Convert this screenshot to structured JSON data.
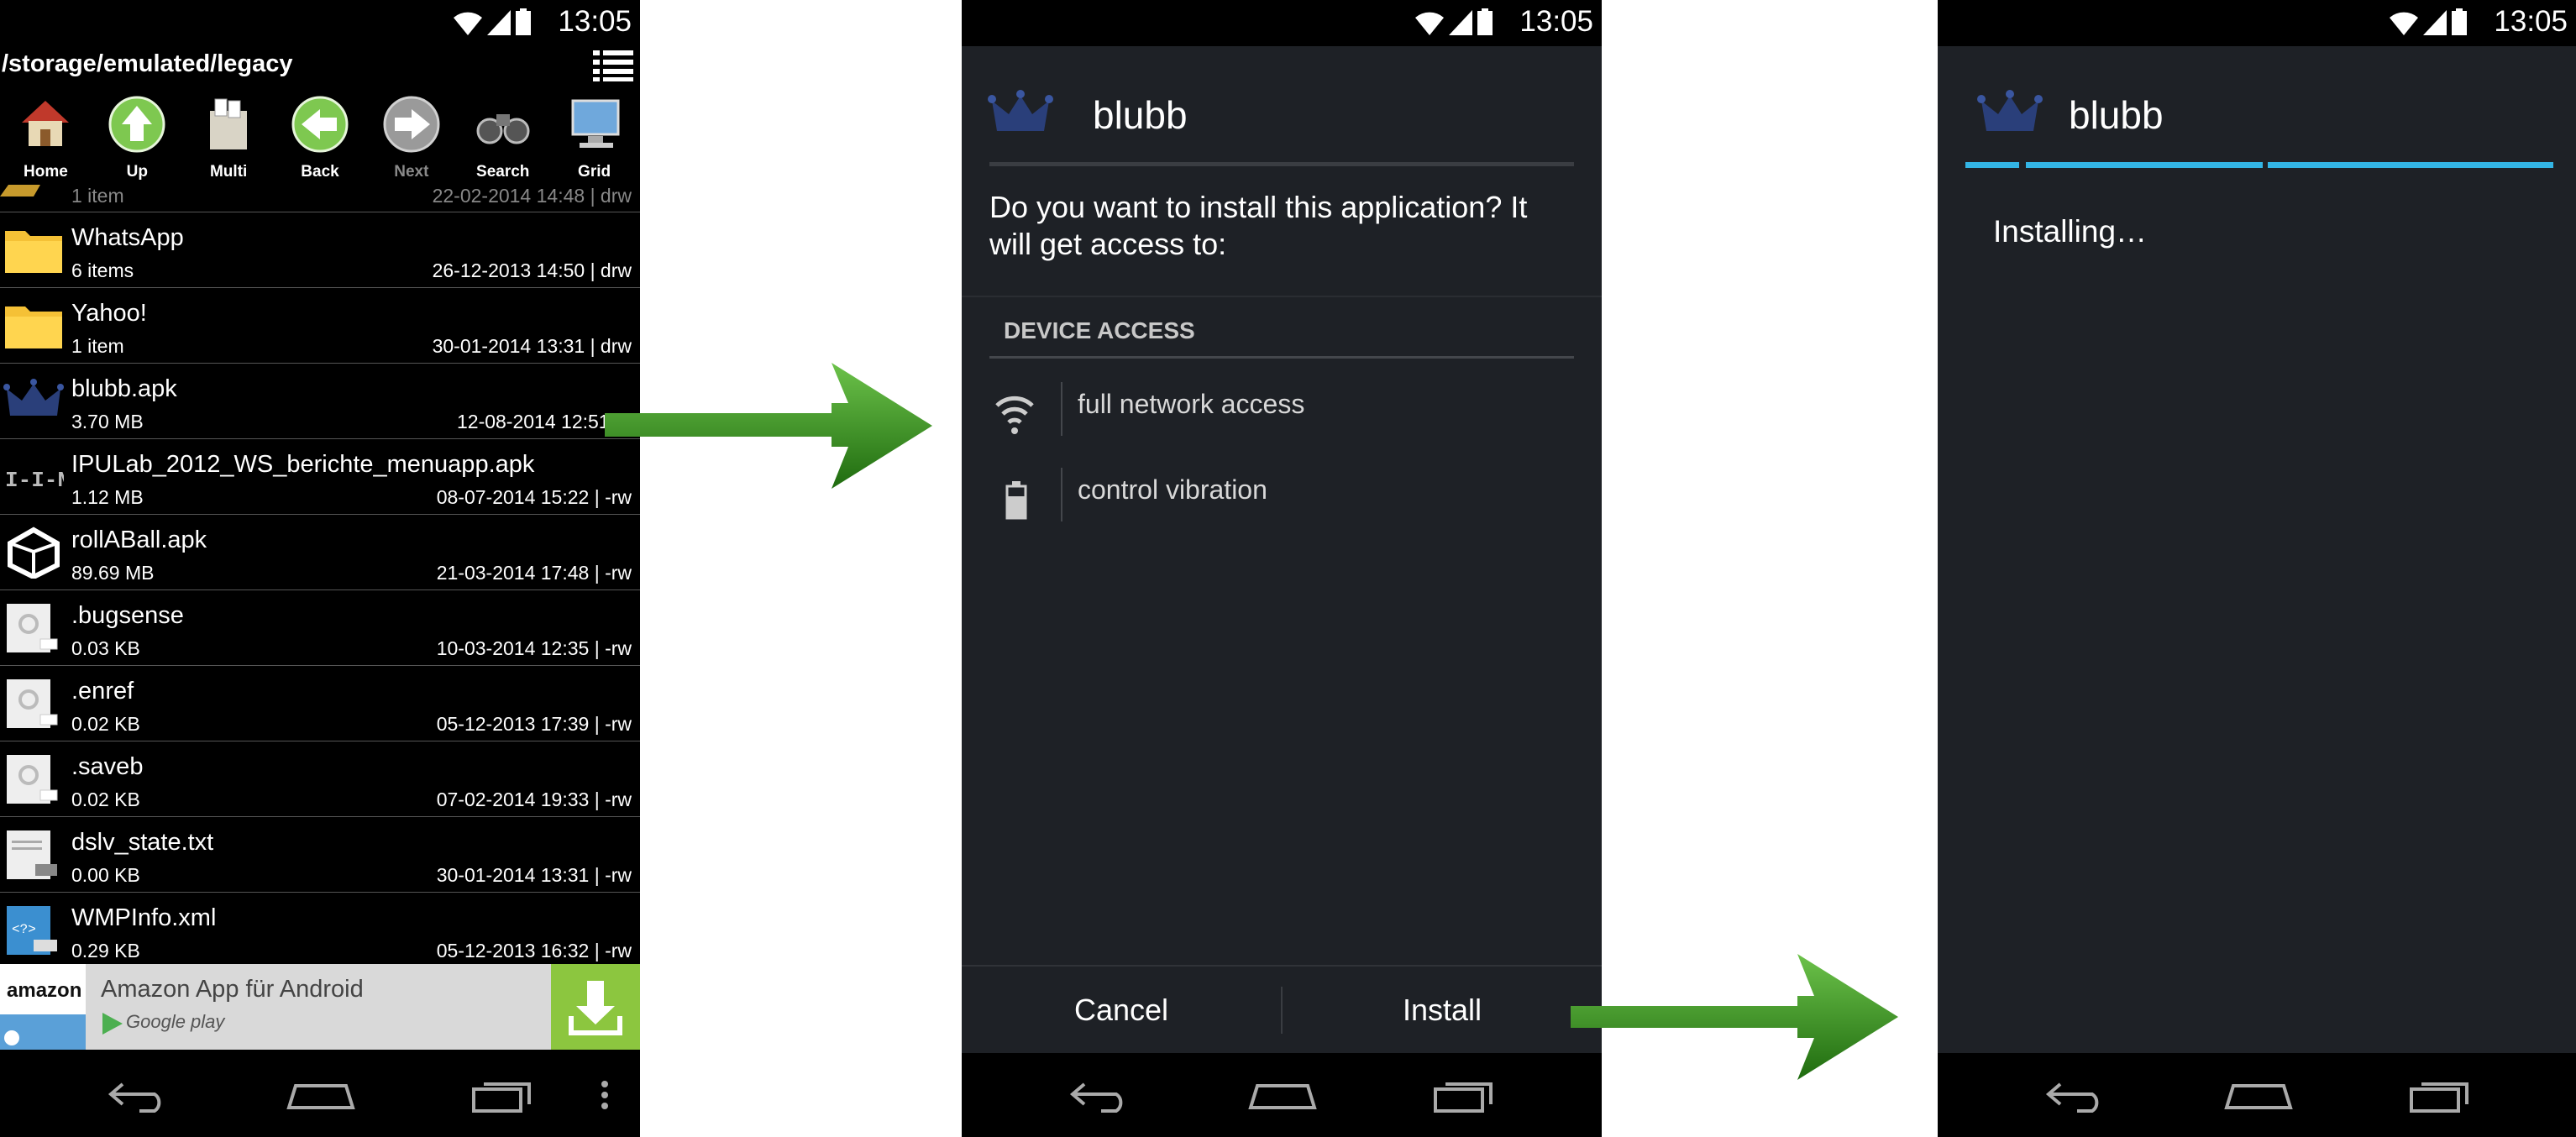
{
  "status": {
    "time": "13:05"
  },
  "file_manager": {
    "path": "/storage/emulated/legacy",
    "toolbar": [
      {
        "label": "Home",
        "icon": "home-icon"
      },
      {
        "label": "Up",
        "icon": "up-arrow-icon"
      },
      {
        "label": "Multi",
        "icon": "multi-select-icon"
      },
      {
        "label": "Back",
        "icon": "back-arrow-icon"
      },
      {
        "label": "Next",
        "icon": "next-arrow-icon"
      },
      {
        "label": "Search",
        "icon": "binoculars-icon"
      },
      {
        "label": "Grid",
        "icon": "monitor-icon"
      }
    ],
    "partial_row": {
      "size": "1 item",
      "date": "22-02-2014 14:48 | drw"
    },
    "files": [
      {
        "name": "WhatsApp",
        "size": "6 items",
        "date": "26-12-2013 14:50 | drw",
        "icon": "folder"
      },
      {
        "name": "Yahoo!",
        "size": "1 item",
        "date": "30-01-2014 13:31 | drw",
        "icon": "folder"
      },
      {
        "name": "blubb.apk",
        "size": "3.70 MB",
        "date": "12-08-2014 12:51 | -",
        "icon": "crown"
      },
      {
        "name": "IPULab_2012_WS_berichte_menuapp.apk",
        "size": "1.12 MB",
        "date": "08-07-2014 15:22 | -rw",
        "icon": "ipu"
      },
      {
        "name": "rollABall.apk",
        "size": "89.69 MB",
        "date": "21-03-2014 17:48 | -rw",
        "icon": "unity"
      },
      {
        "name": ".bugsense",
        "size": "0.03 KB",
        "date": "10-03-2014 12:35 | -rw",
        "icon": "file"
      },
      {
        "name": ".enref",
        "size": "0.02 KB",
        "date": "05-12-2013 17:39 | -rw",
        "icon": "file"
      },
      {
        "name": ".saveb",
        "size": "0.02 KB",
        "date": "07-02-2014 19:33 | -rw",
        "icon": "file"
      },
      {
        "name": "dslv_state.txt",
        "size": "0.00 KB",
        "date": "30-01-2014 13:31 | -rw",
        "icon": "txt"
      },
      {
        "name": "WMPInfo.xml",
        "size": "0.29 KB",
        "date": "05-12-2013 16:32 | -rw",
        "icon": "xml"
      }
    ],
    "ad": {
      "title": "Amazon App für Android",
      "subtitle": "Google play",
      "brand": "amazon"
    }
  },
  "installer": {
    "app_name": "blubb",
    "question": "Do you want to install this application? It will get access to:",
    "section": "DEVICE ACCESS",
    "permissions": [
      {
        "label": "full network access",
        "icon": "wifi-icon"
      },
      {
        "label": "control vibration",
        "icon": "battery-icon"
      }
    ],
    "cancel": "Cancel",
    "install": "Install"
  },
  "installing": {
    "app_name": "blubb",
    "message": "Installing…"
  },
  "colors": {
    "accent": "#33b5e5",
    "arrow": "#2e8b16",
    "ad_button": "#8cc63f"
  }
}
